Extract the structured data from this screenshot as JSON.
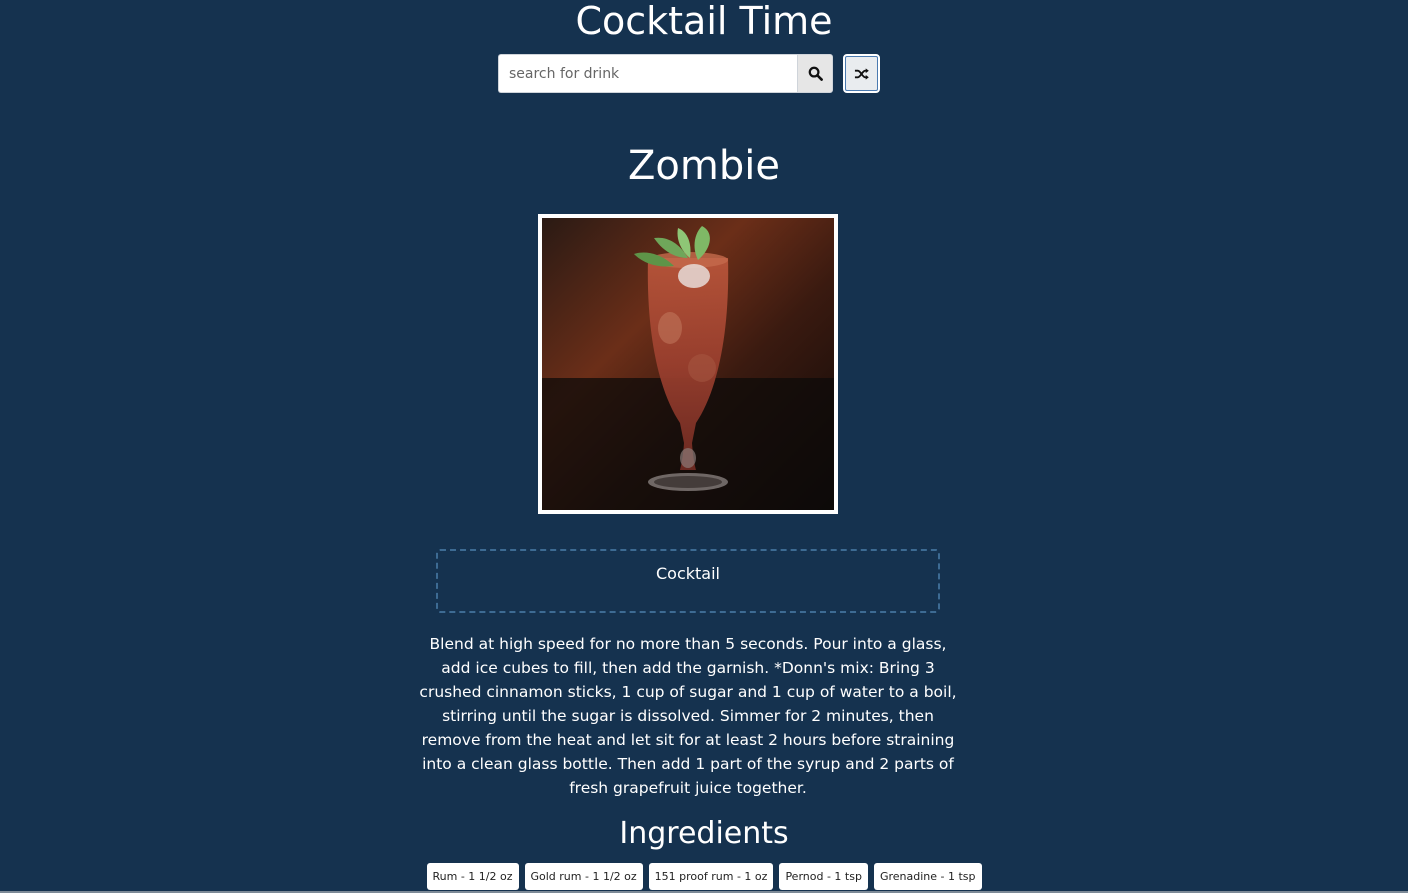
{
  "app": {
    "title": "Cocktail Time"
  },
  "search": {
    "placeholder": "search for drink",
    "value": "",
    "search_icon": "search-icon",
    "random_icon": "shuffle-icon"
  },
  "drink": {
    "name": "Zombie",
    "category": "Cocktail",
    "instructions": "Blend at high speed for no more than 5 seconds. Pour into a glass, add ice cubes to fill, then add the garnish. *Donn's mix: Bring 3 crushed cinnamon sticks, 1 cup of sugar and 1 cup of water to a boil, stirring until the sugar is dissolved. Simmer for 2 minutes, then remove from the heat and let sit for at least 2 hours before straining into a clean glass bottle. Then add 1 part of the syrup and 2 parts of fresh grapefruit juice together."
  },
  "ingredients": {
    "heading": "Ingredients",
    "items": [
      {
        "label": "Rum - 1 1/2 oz"
      },
      {
        "label": "Gold rum - 1 1/2 oz"
      },
      {
        "label": "151 proof rum - 1 oz"
      },
      {
        "label": "Pernod - 1 tsp"
      },
      {
        "label": "Grenadine - 1 tsp"
      }
    ]
  },
  "colors": {
    "background": "#15324f",
    "text": "#ffffff",
    "category_border": "#3d6b93",
    "pill_background": "#ffffff"
  }
}
